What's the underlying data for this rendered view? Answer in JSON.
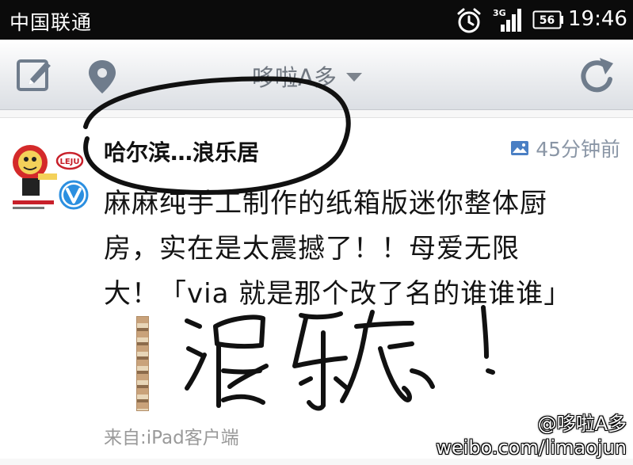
{
  "status_bar": {
    "carrier": "中国联通",
    "network_type": "3G",
    "battery_level": "56",
    "time": "19:46"
  },
  "title_bar": {
    "account_name": "哆啦A多"
  },
  "post": {
    "username": "哈尔滨…浪乐居",
    "time_ago": "45分钟前",
    "text_lines": [
      "麻麻纯手工制作的纸箱版迷你整体厨",
      "房，实在是太震撼了！！母爱无限",
      "大！「via 就是那个改了名的谁谁谁」"
    ],
    "source": "来自:iPad客户端",
    "avatar_text": "LEJU"
  },
  "watermark": {
    "handle": "@哆啦A多",
    "url": "weibo.com/limaojun"
  },
  "colors": {
    "status_bar_bg": "#0b0b0b",
    "accent_icon": "#6f7c8c",
    "verified_blue": "#2b8fe0",
    "time_gray": "#8a96a6"
  }
}
